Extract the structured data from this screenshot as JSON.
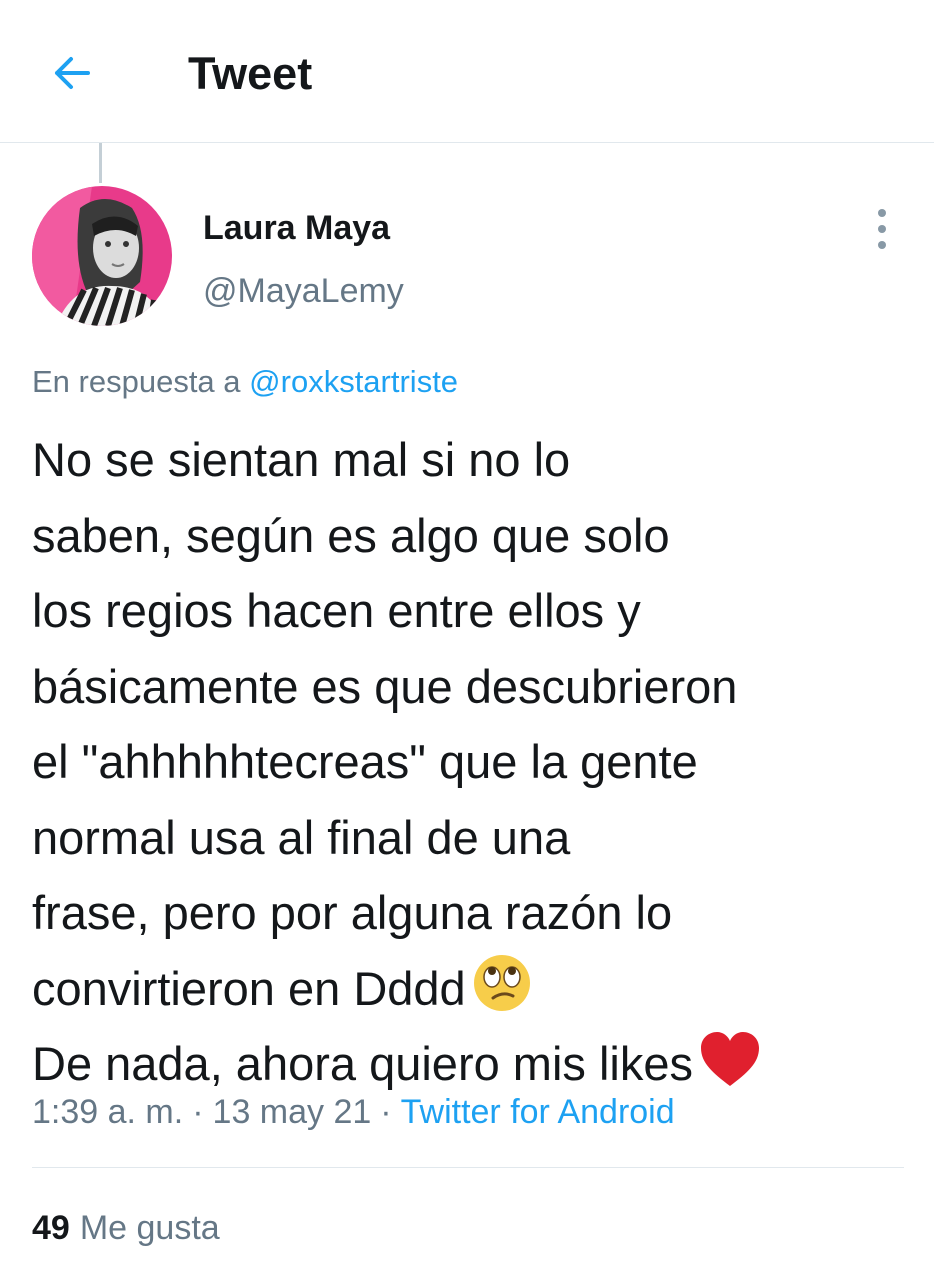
{
  "header": {
    "title": "Tweet",
    "back_icon": "arrow-left-icon",
    "accent_color": "#1da1f2"
  },
  "tweet": {
    "author_name": "Laura Maya",
    "author_handle": "@MayaLemy",
    "avatar_icon": "profile-photo",
    "reply_prefix": "En respuesta a",
    "reply_handle": "@roxkstartriste",
    "text_lines": [
      "No se sientan mal si no lo",
      "saben, según es algo que solo",
      "los regios hacen entre ellos y",
      "básicamente es que descubrieron",
      "el \"ahhhhhtecreas\" que la gente",
      "normal usa al final de una",
      "frase, pero por alguna razón lo",
      "convirtieron en Dddd",
      "De nada, ahora quiero mis likes"
    ],
    "emojis": [
      "eye-roll-emoji",
      "red-heart-emoji"
    ],
    "time": "1:39 a. m.",
    "separator": "·",
    "date": "13 may 21",
    "source": "Twitter for Android",
    "likes_count": "49",
    "likes_label": "Me gusta",
    "more_icon": "more-vertical-icon"
  }
}
